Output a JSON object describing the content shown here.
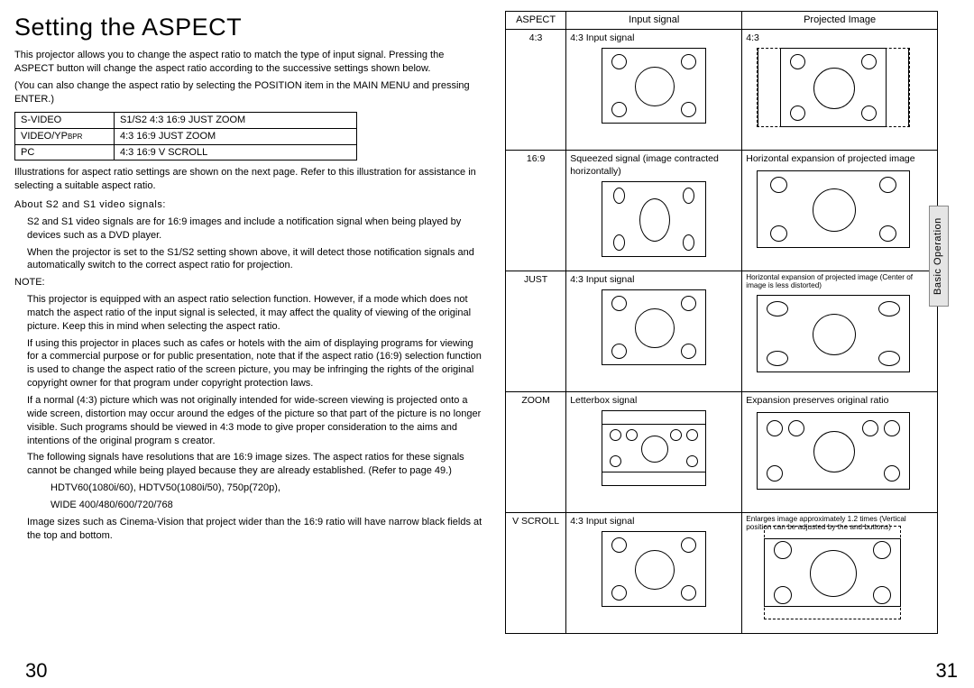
{
  "section_tab": "Basic Operation",
  "title": "Setting the ASPECT",
  "intro": {
    "p1": "This projector allows you to change the aspect ratio to match the type of input signal. Pressing the ASPECT button will change the aspect ratio according to the successive settings shown below.",
    "p2": "(You can also change the aspect ratio by selecting the POSITION item in the MAIN MENU and pressing ENTER.)"
  },
  "signal_table": {
    "rows": [
      {
        "label_pre": "S-VIDEO",
        "label_sub": "",
        "modes": "S1/S2   4:3   16:9   JUST   ZOOM"
      },
      {
        "label_pre": "VIDEO/YP",
        "label_sub": "BPR",
        "modes": "4:3   16:9   JUST   ZOOM"
      },
      {
        "label_pre": "PC",
        "label_sub": "",
        "modes": "4:3   16:9   V SCROLL"
      }
    ]
  },
  "note_after_table": "Illustrations for aspect ratio settings are shown on the next page. Refer to this illustration for assistance in selecting a suitable aspect ratio.",
  "about_heading": "About S2 and S1 video signals:",
  "about": {
    "p1": "S2 and S1 video signals are for 16:9 images and include a notification signal when being played by devices such as a DVD player.",
    "p2": "When the projector is set to the  S1/S2  setting shown above, it will detect those notification signals and automatically switch to the correct aspect ratio for projection."
  },
  "note_label": "NOTE:",
  "notes": {
    "n1": "This projector is equipped with an aspect ratio selection function. However, if a mode which does not match the aspect ratio of the input signal is selected, it may affect the quality of viewing of the original picture. Keep this in mind when selecting the aspect ratio.",
    "n2": "If using this projector in places such as cafes or hotels with the aim of displaying programs for viewing for a commercial purpose or for public presentation, note that if the aspect ratio (16:9) selection function is used to change the aspect ratio of the screen picture, you may be infringing the rights of the original copyright owner for that program under copyright protection laws.",
    "n3": "If a normal (4:3) picture which was not originally intended for wide-screen viewing is projected onto a wide screen, distortion may occur around the edges of the picture so that part of the picture is no longer visible. Such programs should be viewed in 4:3 mode to give proper consideration to the aims and intentions of the original program s creator.",
    "n4": "The following signals have resolutions that are 16:9 image sizes. The aspect ratios for these signals cannot be changed while being played because they are already established. (Refer to page 49.)",
    "n4_sub1": "HDTV60(1080i/60), HDTV50(1080i/50), 750p(720p),",
    "n4_sub2": "WIDE 400/480/600/720/768",
    "n5": "Image sizes such as Cinema-Vision that project wider than the 16:9 ratio will have narrow black fields at the top and bottom."
  },
  "aspect_table": {
    "headers": {
      "c1": "ASPECT",
      "c2": "Input signal",
      "c3": "Projected Image"
    },
    "rows": [
      {
        "aspect": "4:3",
        "input": "4:3 Input signal",
        "proj": "4:3"
      },
      {
        "aspect": "16:9",
        "input": "Squeezed signal (image contracted horizontally)",
        "proj": "Horizontal expansion of projected image"
      },
      {
        "aspect": "JUST",
        "input": "4:3 Input signal",
        "proj": "Horizontal expansion of projected image (Center of image is less distorted)"
      },
      {
        "aspect": "ZOOM",
        "input": "Letterbox signal",
        "proj": "Expansion preserves original ratio"
      },
      {
        "aspect": "V SCROLL",
        "input": "4:3 Input signal",
        "proj": "Enlarges image approximately 1.2 times (Vertical position can be adjusted by the      and      buttons)"
      }
    ]
  },
  "page_left": "30",
  "page_right": "31"
}
